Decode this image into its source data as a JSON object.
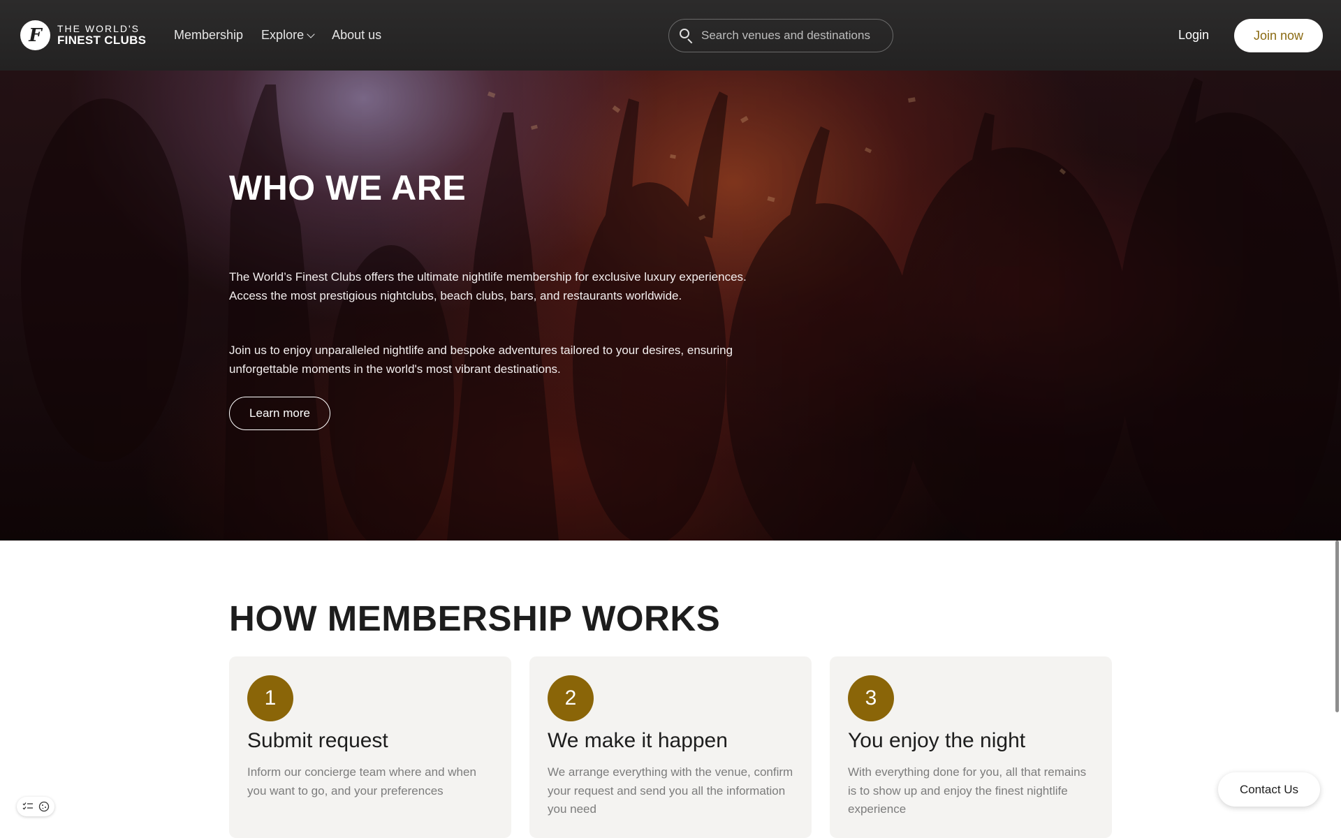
{
  "header": {
    "logo_line1": "THE WORLD'S",
    "logo_line2": "FINEST CLUBS",
    "logo_mark": "F",
    "nav": [
      "Membership",
      "Explore",
      "About us"
    ],
    "search_placeholder": "Search venues and destinations",
    "login_label": "Login",
    "join_label": "Join now"
  },
  "hero": {
    "title": "WHO WE ARE",
    "paragraph1": "The World’s Finest Clubs offers the ultimate nightlife membership for exclusive luxury experiences. Access the most prestigious nightclubs, beach clubs, bars, and restaurants worldwide.",
    "paragraph2": "Join us to enjoy unparalleled nightlife and bespoke adventures tailored to your desires, ensuring unforgettable moments in the world's most vibrant destinations.",
    "button_label": "Learn more"
  },
  "membership": {
    "title": "HOW MEMBERSHIP WORKS",
    "steps": [
      {
        "number": "1",
        "title": "Submit request",
        "description": "Inform our concierge team where and when you want to go, and your preferences"
      },
      {
        "number": "2",
        "title": "We make it happen",
        "description": "We arrange everything with the venue, confirm your request and send you all the information you need"
      },
      {
        "number": "3",
        "title": "You enjoy the night",
        "description": "With everything done for you, all that remains is to show up and enjoy the finest nightlife experience"
      }
    ]
  },
  "contact_label": "Contact Us",
  "colors": {
    "header_bg": "#2a2929",
    "accent_gold": "#8a6508",
    "join_text": "#8a6a12",
    "card_bg": "#f4f3f1"
  },
  "icons": {
    "search": "search-icon",
    "explore_dropdown": "chevron-down-icon",
    "cookie_widget": [
      "checklist-icon",
      "cookie-icon"
    ]
  }
}
